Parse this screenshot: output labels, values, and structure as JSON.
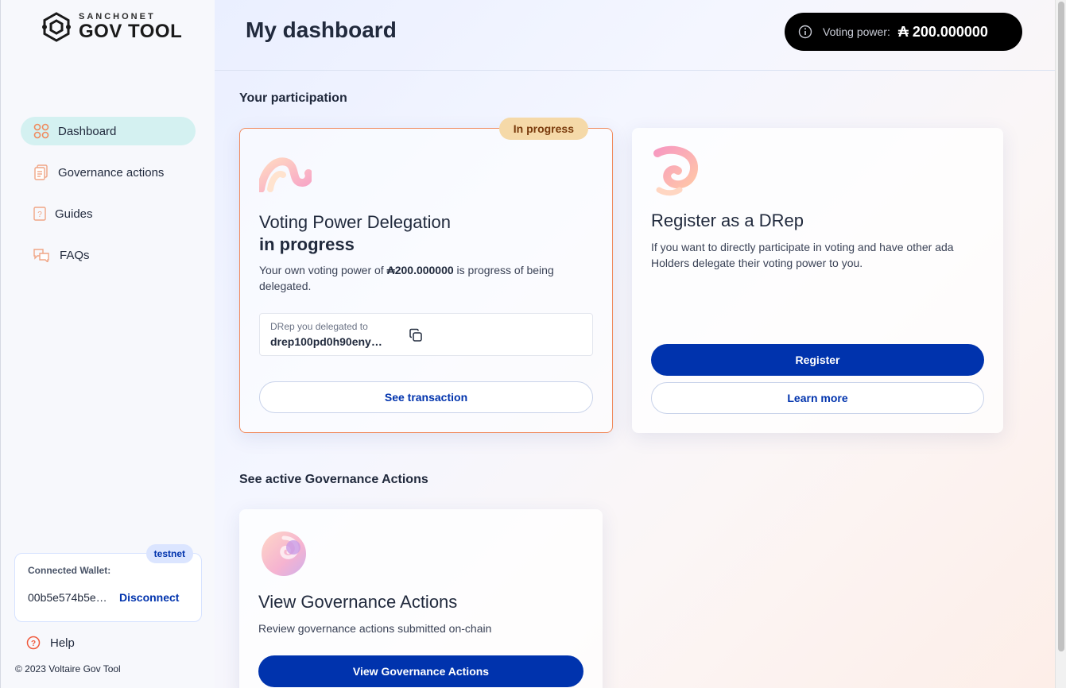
{
  "brand": {
    "top": "SANCHONET",
    "bottom": "GOV TOOL"
  },
  "sidebar": {
    "items": [
      {
        "label": "Dashboard",
        "icon": "dashboard-grid-icon",
        "active": true
      },
      {
        "label": "Governance actions",
        "icon": "document-icon"
      },
      {
        "label": "Guides",
        "icon": "guide-book-icon"
      },
      {
        "label": "FAQs",
        "icon": "chat-bubbles-icon"
      }
    ],
    "wallet": {
      "network_badge": "testnet",
      "label": "Connected Wallet:",
      "address": "00b5e574b5e…",
      "disconnect_label": "Disconnect"
    },
    "help_label": "Help",
    "copyright": "© 2023 Voltaire Gov Tool"
  },
  "header": {
    "title": "My dashboard",
    "voting_power_label": "Voting power:",
    "voting_power_value": "₳ 200.000000"
  },
  "participation": {
    "section_title": "Your participation",
    "delegation_card": {
      "badge": "In progress",
      "title_line1": "Voting Power Delegation",
      "title_line2": "in progress",
      "desc_prefix": "Your own voting power of ",
      "desc_amount": "₳200.000000",
      "desc_suffix": " is progress of being delegated.",
      "drep_label": "DRep you delegated to",
      "drep_id": "drep100pd0h90eny…",
      "button": "See transaction"
    },
    "drep_card": {
      "title": "Register as a DRep",
      "desc": "If you want to directly participate in voting and have other ada Holders delegate their voting power to you.",
      "primary_button": "Register",
      "secondary_button": "Learn more"
    }
  },
  "governance": {
    "section_title": "See active Governance Actions",
    "card": {
      "title": "View Governance Actions",
      "desc": "Review governance actions submitted on-chain",
      "button": "View Governance Actions"
    }
  },
  "colors": {
    "primary": "#0033ad",
    "active_nav": "#d4f1f1",
    "badge_bg": "#f5d9a8",
    "highlight_border": "#f08a5d"
  }
}
